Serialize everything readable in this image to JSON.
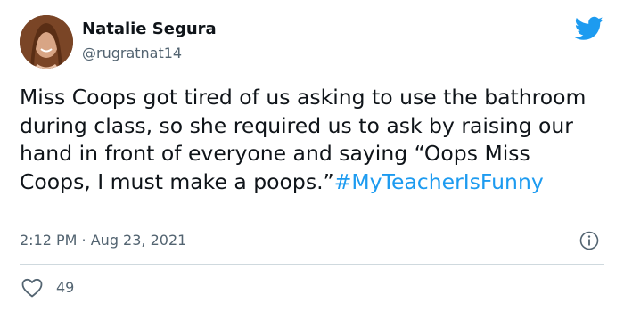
{
  "author": {
    "display_name": "Natalie Segura",
    "handle": "@rugratnat14",
    "avatar_icon": "profile-photo"
  },
  "tweet": {
    "text": "Miss Coops got tired of us asking to use the bathroom during class, so she required us to ask by raising our hand in front of everyone and saying “Oops Miss Coops, I must make a poops.”",
    "hashtag": "#MyTeacherIsFunny",
    "timestamp": "2:12 PM · Aug 23, 2021"
  },
  "actions": {
    "likes": "49",
    "like_icon": "heart-icon",
    "info_icon": "info-icon"
  },
  "colors": {
    "brand_blue": "#1d9bf0",
    "secondary_text": "#536471",
    "divider": "#cfd9de"
  }
}
